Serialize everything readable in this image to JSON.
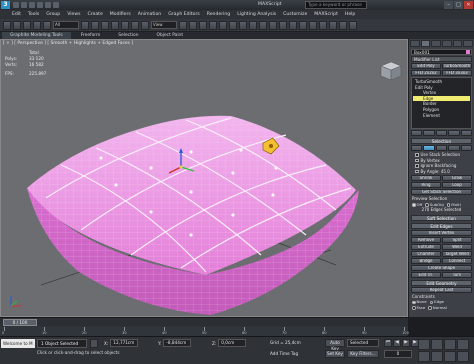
{
  "title_bar": {
    "title": "3ds Max",
    "app_label": "3",
    "window_caption": "MAXScript",
    "search_placeholder": "Type a keyword or phrase",
    "min": "–",
    "max": "□",
    "close": "✕"
  },
  "menu": [
    "Edit",
    "Tools",
    "Group",
    "Views",
    "Create",
    "Modifiers",
    "Animation",
    "Graph Editors",
    "Rendering",
    "Lighting Analysis",
    "Customize",
    "MAXScript",
    "Help"
  ],
  "toolbar": {
    "selection_filter": "All",
    "view": "View"
  },
  "ribbon": {
    "tabs": [
      "Graphite Modeling Tools",
      "Freeform",
      "Selection",
      "Object Paint"
    ],
    "active": 0
  },
  "viewport": {
    "label": "[ + ] [ Perspective ] [ Smooth + Highlights + Edged Faces ]",
    "stats": {
      "total_label": "Total",
      "polys_label": "Polys:",
      "polys_value": "33 120",
      "verts_label": "Verts:",
      "verts_value": "16 582",
      "fps_label": "FPS:",
      "fps_value": "225.897"
    },
    "mesh_color": "#e58ae0",
    "wire_color": "#f8e3f6",
    "gizmo_color": "#f5c030"
  },
  "command_panel": {
    "tab_count": 6,
    "object_name": "Box001",
    "modifier_list": "Modifier List",
    "quick_buttons": [
      [
        "Edit Poly",
        "TurboSmooth"
      ],
      [
        "FFD 2x2x2",
        "FFD 3x3x3"
      ]
    ],
    "stack": [
      {
        "label": "TurboSmooth",
        "level": 0,
        "hl": false
      },
      {
        "label": "Edit Poly",
        "level": 0,
        "hl": false
      },
      {
        "label": "Vertex",
        "level": 1,
        "hl": false
      },
      {
        "label": "Edge",
        "level": 1,
        "hl": true
      },
      {
        "label": "Border",
        "level": 1,
        "hl": false
      },
      {
        "label": "Polygon",
        "level": 1,
        "hl": false
      },
      {
        "label": "Element",
        "level": 1,
        "hl": false
      }
    ],
    "selection_rollout": "Selection",
    "checks": [
      {
        "label": "Use Stack Selection",
        "on": false
      },
      {
        "label": "By Vertex",
        "on": false
      },
      {
        "label": "Ignore Backfacing",
        "on": false
      },
      {
        "label": "By Angle: 45.0",
        "on": false
      }
    ],
    "shrink_grow": [
      "Shrink",
      "Grow"
    ],
    "ring_loop": [
      "Ring",
      "Loop"
    ],
    "get_stack": "Get Stack Selection",
    "preview_label": "Preview Selection",
    "preview_opts": [
      {
        "label": "Off",
        "on": true
      },
      {
        "label": "SubObj",
        "on": false
      },
      {
        "label": "Multi",
        "on": false
      }
    ],
    "edges_selected": "270 Edges Selected",
    "soft_selection": "Soft Selection",
    "edit_edges": "Edit Edges",
    "insert_vertex": "Insert Vertex",
    "remove_split": [
      "Remove",
      "Split"
    ],
    "extrude_weld": [
      "Extrude",
      "Weld"
    ],
    "chamfer_target": [
      "Chamfer",
      "Target Weld"
    ],
    "bridge_connect": [
      "Bridge",
      "Connect"
    ],
    "create_shape": "Create Shape",
    "edit_tri_turn": [
      "Edit Tri.",
      "Turn"
    ],
    "edit_geometry": "Edit Geometry",
    "repeat_last": "Repeat Last",
    "constraints": "Constraints",
    "constraint_opts": [
      {
        "label": "None",
        "on": true
      },
      {
        "label": "Edge",
        "on": false
      },
      {
        "label": "Face",
        "on": false
      },
      {
        "label": "Normal",
        "on": false
      }
    ]
  },
  "timeline": {
    "frame_display": "0 / 100",
    "ticks": [
      "0",
      "10",
      "20",
      "30",
      "40",
      "50",
      "60",
      "70",
      "80",
      "90",
      "100"
    ]
  },
  "status": {
    "maxscript": "Welcome to M",
    "selected": "1 Object Selected",
    "prompt": "Click or click-and-drag to select objects",
    "x_label": "X:",
    "x": "12,771cm",
    "y_label": "Y:",
    "y": "-8,844cm",
    "z_label": "Z:",
    "z": "0,0cm",
    "grid": "Grid = 25,4cm",
    "add_time_tag": "Add Time Tag",
    "auto_key": "Auto Key",
    "selected_dd": "Selected",
    "set_key": "Set Key",
    "key_filters": "Key Filters...",
    "frame": "0"
  }
}
